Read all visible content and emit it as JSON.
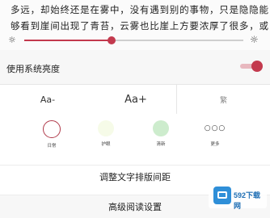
{
  "reader_text": {
    "line1": "多远，却始终还是在雾中，没有遇到别的事物，只是隐隐能",
    "line2": "够看到崖间出现了青苔，云雾也比崖上方要浓厚了很多，或"
  },
  "brightness": {
    "low_icon": "☼",
    "high_icon": "☼",
    "level_fraction": 0.4
  },
  "system_brightness": {
    "label": "使用系统亮度",
    "enabled": true
  },
  "font_size": {
    "smaller_label": "Aa-",
    "larger_label": "Aa+",
    "third_label": "繁"
  },
  "themes": [
    {
      "label": "日常"
    },
    {
      "label": "护眼"
    },
    {
      "label": "清新"
    },
    {
      "label": "更多",
      "icon_text": "○○○"
    }
  ],
  "layout_link": {
    "label": "调整文字排版间距"
  },
  "advanced_link": {
    "label": "高级阅读设置"
  },
  "watermark": {
    "text": "592下载网"
  },
  "colors": {
    "accent": "#c33a4e",
    "eye_theme": "#f6fbe8",
    "fresh_theme": "#cdeccd"
  }
}
